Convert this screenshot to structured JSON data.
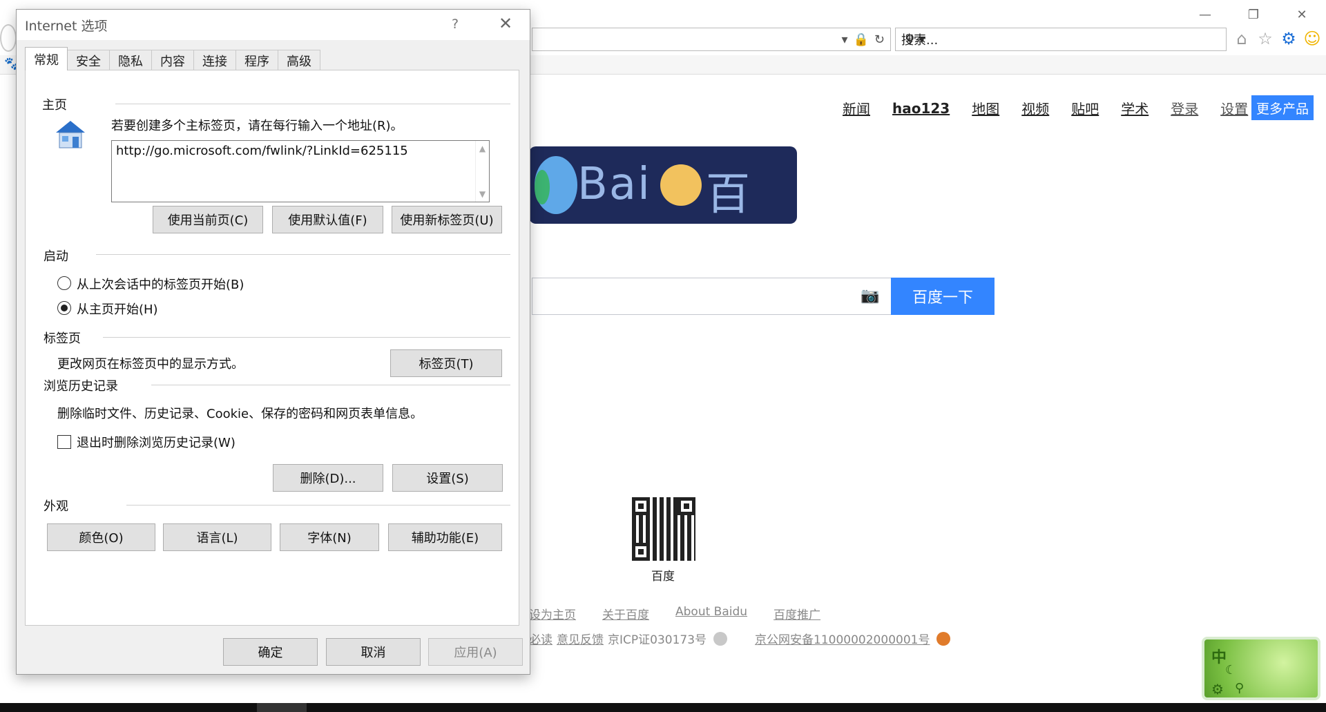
{
  "browser": {
    "window_controls": [
      "—",
      "❐",
      "✕"
    ],
    "search_placeholder": "搜索...",
    "icons": [
      "home-icon",
      "star-icon",
      "gear-icon",
      "smiley-icon"
    ]
  },
  "baidu": {
    "nav": [
      "新闻",
      "hao123",
      "地图",
      "视频",
      "贴吧",
      "学术",
      "登录",
      "设置"
    ],
    "more_products": "更多产品",
    "logo_text_left": "Bai",
    "logo_text_right": "百度",
    "search_button": "百度一下",
    "qr_label": "百度",
    "footer_row1": [
      "设为主页",
      "关于百度",
      "About  Baidu",
      "百度推广"
    ],
    "footer_row2_prefix": "必读",
    "footer_row2_feedback": "意见反馈",
    "footer_row2_icp": "京ICP证030173号",
    "footer_row2_police": "京公网安备11000002000001号",
    "ime": {
      "lang": "中"
    }
  },
  "dialog": {
    "title": "Internet 选项",
    "help": "?",
    "close": "✕",
    "tabs": [
      "常规",
      "安全",
      "隐私",
      "内容",
      "连接",
      "程序",
      "高级"
    ],
    "home": {
      "heading": "主页",
      "instruction": "若要创建多个主标签页，请在每行输入一个地址(R)。",
      "url_value": "http://go.microsoft.com/fwlink/?LinkId=625115",
      "btn_current": "使用当前页(C)",
      "btn_default": "使用默认值(F)",
      "btn_newtab": "使用新标签页(U)"
    },
    "startup": {
      "heading": "启动",
      "option_last_session": "从上次会话中的标签页开始(B)",
      "option_home": "从主页开始(H)",
      "selected": "option_home"
    },
    "tabs_section": {
      "heading": "标签页",
      "description": "更改网页在标签页中的显示方式。",
      "btn_tabs": "标签页(T)"
    },
    "history": {
      "heading": "浏览历史记录",
      "description": "删除临时文件、历史记录、Cookie、保存的密码和网页表单信息。",
      "checkbox_label": "退出时删除浏览历史记录(W)",
      "checkbox_checked": false,
      "btn_delete": "删除(D)...",
      "btn_settings": "设置(S)"
    },
    "appearance": {
      "heading": "外观",
      "btn_colors": "颜色(O)",
      "btn_languages": "语言(L)",
      "btn_fonts": "字体(N)",
      "btn_accessibility": "辅助功能(E)"
    },
    "footer": {
      "ok": "确定",
      "cancel": "取消",
      "apply": "应用(A)"
    }
  }
}
